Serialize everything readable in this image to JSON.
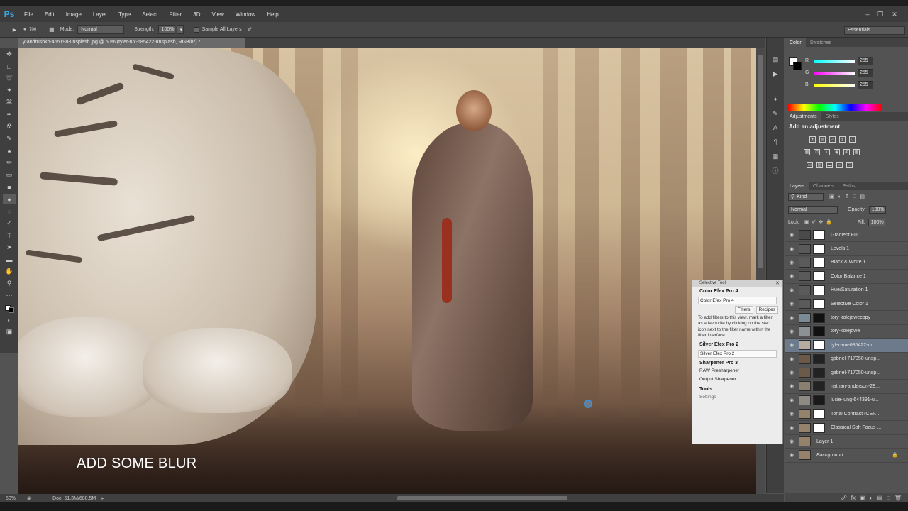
{
  "app": {
    "logo": "Ps"
  },
  "menu": [
    "File",
    "Edit",
    "Image",
    "Layer",
    "Type",
    "Select",
    "Filter",
    "3D",
    "View",
    "Window",
    "Help"
  ],
  "options": {
    "brush_size": "700",
    "mode_label": "Mode:",
    "mode_value": "Normal",
    "strength_label": "Strength:",
    "strength_value": "100%",
    "sample_label": "Sample All Layers",
    "workspace": "Essentials"
  },
  "document": {
    "tab_title": "y-andrushko-465198-unsplash.jpg @ 50% (tyler-nix-685422-unsplash, RGB/8*) *",
    "caption": "ADD SOME BLUR"
  },
  "status": {
    "zoom": "50%",
    "doc_size": "Doc: 51,3M/680,5M"
  },
  "color_panel": {
    "tabs": [
      "Color",
      "Swatches"
    ],
    "channels": [
      {
        "label": "R",
        "value": "255"
      },
      {
        "label": "G",
        "value": "255"
      },
      {
        "label": "B",
        "value": "255"
      }
    ]
  },
  "adjustments_panel": {
    "tabs": [
      "Adjustments",
      "Styles"
    ],
    "title": "Add an adjustment"
  },
  "layers_panel": {
    "tabs": [
      "Layers",
      "Channels",
      "Paths"
    ],
    "kind_label": "Kind",
    "blend_mode": "Normal",
    "opacity_label": "Opacity:",
    "opacity_value": "100%",
    "lock_label": "Lock:",
    "fill_label": "Fill:",
    "fill_value": "100%",
    "layers": [
      {
        "name": "Gradient Fill 1",
        "thumb": "#4a4a4a",
        "mask": "#ffffff"
      },
      {
        "name": "Levels 1",
        "thumb": "#5a5a5a",
        "mask": "#ffffff"
      },
      {
        "name": "Black & White 1",
        "thumb": "#5a5a5a",
        "mask": "#ffffff"
      },
      {
        "name": "Color Balance 1",
        "thumb": "#5a5a5a",
        "mask": "#ffffff"
      },
      {
        "name": "Hue/Saturation 1",
        "thumb": "#5a5a5a",
        "mask": "#ffffff"
      },
      {
        "name": "Selective Color 1",
        "thumb": "#5a5a5a",
        "mask": "#ffffff"
      },
      {
        "name": "tory-kolejowecopy",
        "thumb": "#7b8b96",
        "mask": "#111111"
      },
      {
        "name": "tory-kolejowe",
        "thumb": "#8c9196",
        "mask": "#111111"
      },
      {
        "name": "tyler-nix-685422-un...",
        "thumb": "#b7aca0",
        "mask": "#ffffff"
      },
      {
        "name": "gabriel-717050-unsp...",
        "thumb": "#6b5a49",
        "mask": "#222222"
      },
      {
        "name": "gabriel-717050-unsp...",
        "thumb": "#6b5a49",
        "mask": "#222222"
      },
      {
        "name": "nathan-anderson-28...",
        "thumb": "#8a8072",
        "mask": "#222222"
      },
      {
        "name": "lucie-jung-644391-u...",
        "thumb": "#8d8a84",
        "mask": "#1a1a1a"
      },
      {
        "name": "Tonal Contrast (CEF...",
        "thumb": "#95826d",
        "mask": "#ffffff"
      },
      {
        "name": "Classical Soft Focus ...",
        "thumb": "#95826d",
        "mask": "#ffffff"
      },
      {
        "name": "Layer 1",
        "thumb": "#95826d",
        "mask": ""
      },
      {
        "name": "Background",
        "thumb": "#95826d",
        "mask": ""
      }
    ]
  },
  "selective_tool": {
    "title": "Selective Tool",
    "color_efex": "Color Efex Pro 4",
    "color_efex_item": "Color Efex Pro 4",
    "tab_filters": "Filters",
    "tab_recipes": "Recipes",
    "help_text": "To add filters to this view, mark a filter as a favourite by clicking on the star icon next to the filter name within the filter interface.",
    "silver_efex": "Silver Efex Pro 2",
    "silver_efex_item": "Silver Efex Pro 2",
    "sharpener": "Sharpener Pro 3",
    "sharpener_item_1": "RAW Presharpener",
    "sharpener_item_2": "Output Sharpener",
    "tools": "Tools",
    "settings": "Settings"
  }
}
